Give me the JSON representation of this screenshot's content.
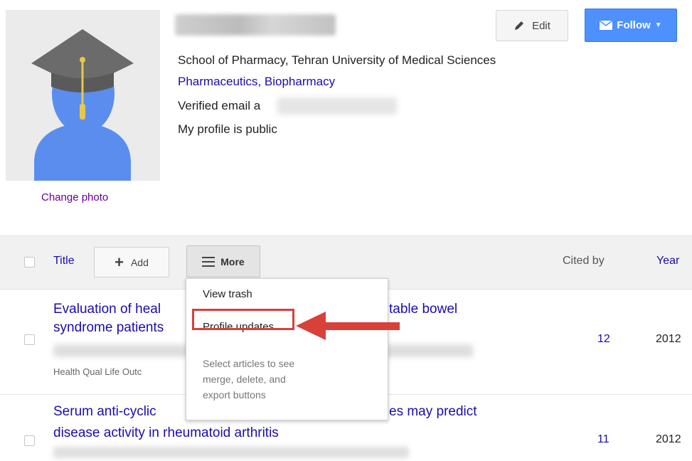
{
  "profile": {
    "change_photo": "Change photo",
    "affiliation": "School of Pharmacy, Tehran University of Medical Sciences",
    "interests": "Pharmaceutics, Biopharmacy",
    "email_label": "Verified email a",
    "visibility": "My profile is public"
  },
  "buttons": {
    "edit": "Edit",
    "follow": "Follow"
  },
  "table": {
    "col_title": "Title",
    "add": "Add",
    "more": "More",
    "col_cited": "Cited by",
    "col_year": "Year"
  },
  "menu": {
    "view_trash": "View trash",
    "profile_updates": "Profile updates",
    "help_text_1": "Select articles to see",
    "help_text_2": "merge, delete, and",
    "help_text_3": "export buttons"
  },
  "articles": [
    {
      "title_line1_a": "Evaluation of heal",
      "title_line1_b": "table bowel",
      "title_line2": "syndrome patients",
      "venue": "Health Qual Life Outc",
      "cited_by": "12",
      "year": "2012"
    },
    {
      "title_line1_a": "Serum anti-cyclic",
      "title_line1_b": "es may predict",
      "title_line2": "disease activity in rheumatoid arthritis",
      "cited_by": "11",
      "year": "2012"
    }
  ],
  "colors": {
    "link_blue": "#1a0dab",
    "follow_blue": "#4d90fe",
    "highlight_red": "#d8403a",
    "avatar_blue": "#5b8def",
    "cap_gray": "#6b6b6b",
    "tassel_gold": "#e8c84a"
  }
}
